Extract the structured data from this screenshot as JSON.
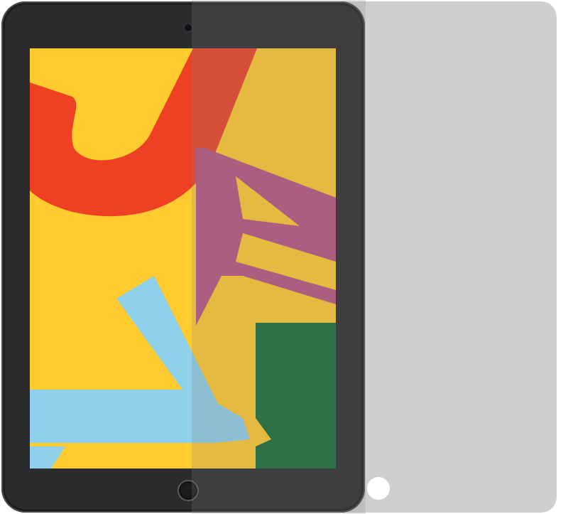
{
  "scene": {
    "subject": "tablet-with-privacy-screen-protector",
    "device_color": "#2b2b2d",
    "filter_color": "#cfcfcf",
    "wallpaper_colors": {
      "background": "#ffcb2e",
      "red": "#ee4023",
      "pink": "#b85480",
      "green": "#186b35",
      "blue": "#8fd0ea"
    }
  }
}
